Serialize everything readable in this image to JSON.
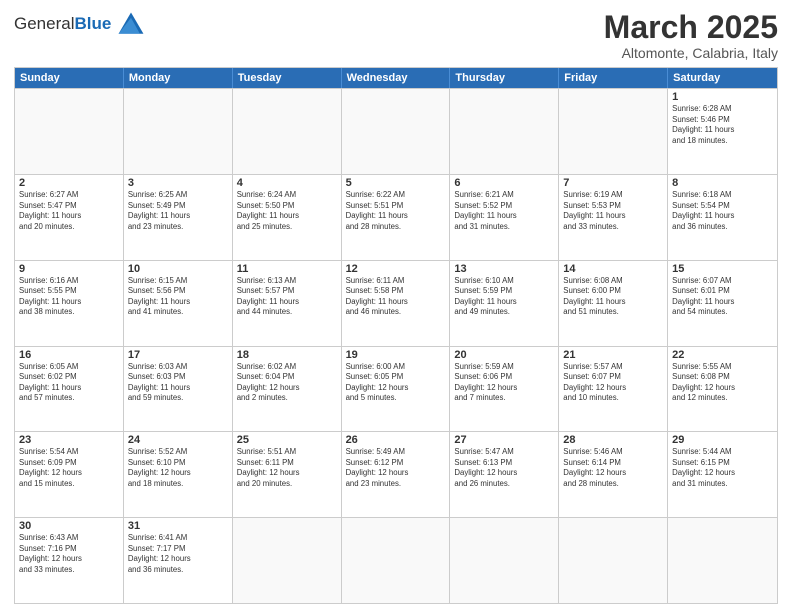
{
  "header": {
    "logo_general": "General",
    "logo_blue": "Blue",
    "month_year": "March 2025",
    "location": "Altomonte, Calabria, Italy"
  },
  "weekdays": [
    "Sunday",
    "Monday",
    "Tuesday",
    "Wednesday",
    "Thursday",
    "Friday",
    "Saturday"
  ],
  "weeks": [
    [
      {
        "day": "",
        "info": ""
      },
      {
        "day": "",
        "info": ""
      },
      {
        "day": "",
        "info": ""
      },
      {
        "day": "",
        "info": ""
      },
      {
        "day": "",
        "info": ""
      },
      {
        "day": "",
        "info": ""
      },
      {
        "day": "1",
        "info": "Sunrise: 6:28 AM\nSunset: 5:46 PM\nDaylight: 11 hours\nand 18 minutes."
      }
    ],
    [
      {
        "day": "2",
        "info": "Sunrise: 6:27 AM\nSunset: 5:47 PM\nDaylight: 11 hours\nand 20 minutes."
      },
      {
        "day": "3",
        "info": "Sunrise: 6:25 AM\nSunset: 5:49 PM\nDaylight: 11 hours\nand 23 minutes."
      },
      {
        "day": "4",
        "info": "Sunrise: 6:24 AM\nSunset: 5:50 PM\nDaylight: 11 hours\nand 25 minutes."
      },
      {
        "day": "5",
        "info": "Sunrise: 6:22 AM\nSunset: 5:51 PM\nDaylight: 11 hours\nand 28 minutes."
      },
      {
        "day": "6",
        "info": "Sunrise: 6:21 AM\nSunset: 5:52 PM\nDaylight: 11 hours\nand 31 minutes."
      },
      {
        "day": "7",
        "info": "Sunrise: 6:19 AM\nSunset: 5:53 PM\nDaylight: 11 hours\nand 33 minutes."
      },
      {
        "day": "8",
        "info": "Sunrise: 6:18 AM\nSunset: 5:54 PM\nDaylight: 11 hours\nand 36 minutes."
      }
    ],
    [
      {
        "day": "9",
        "info": "Sunrise: 6:16 AM\nSunset: 5:55 PM\nDaylight: 11 hours\nand 38 minutes."
      },
      {
        "day": "10",
        "info": "Sunrise: 6:15 AM\nSunset: 5:56 PM\nDaylight: 11 hours\nand 41 minutes."
      },
      {
        "day": "11",
        "info": "Sunrise: 6:13 AM\nSunset: 5:57 PM\nDaylight: 11 hours\nand 44 minutes."
      },
      {
        "day": "12",
        "info": "Sunrise: 6:11 AM\nSunset: 5:58 PM\nDaylight: 11 hours\nand 46 minutes."
      },
      {
        "day": "13",
        "info": "Sunrise: 6:10 AM\nSunset: 5:59 PM\nDaylight: 11 hours\nand 49 minutes."
      },
      {
        "day": "14",
        "info": "Sunrise: 6:08 AM\nSunset: 6:00 PM\nDaylight: 11 hours\nand 51 minutes."
      },
      {
        "day": "15",
        "info": "Sunrise: 6:07 AM\nSunset: 6:01 PM\nDaylight: 11 hours\nand 54 minutes."
      }
    ],
    [
      {
        "day": "16",
        "info": "Sunrise: 6:05 AM\nSunset: 6:02 PM\nDaylight: 11 hours\nand 57 minutes."
      },
      {
        "day": "17",
        "info": "Sunrise: 6:03 AM\nSunset: 6:03 PM\nDaylight: 11 hours\nand 59 minutes."
      },
      {
        "day": "18",
        "info": "Sunrise: 6:02 AM\nSunset: 6:04 PM\nDaylight: 12 hours\nand 2 minutes."
      },
      {
        "day": "19",
        "info": "Sunrise: 6:00 AM\nSunset: 6:05 PM\nDaylight: 12 hours\nand 5 minutes."
      },
      {
        "day": "20",
        "info": "Sunrise: 5:59 AM\nSunset: 6:06 PM\nDaylight: 12 hours\nand 7 minutes."
      },
      {
        "day": "21",
        "info": "Sunrise: 5:57 AM\nSunset: 6:07 PM\nDaylight: 12 hours\nand 10 minutes."
      },
      {
        "day": "22",
        "info": "Sunrise: 5:55 AM\nSunset: 6:08 PM\nDaylight: 12 hours\nand 12 minutes."
      }
    ],
    [
      {
        "day": "23",
        "info": "Sunrise: 5:54 AM\nSunset: 6:09 PM\nDaylight: 12 hours\nand 15 minutes."
      },
      {
        "day": "24",
        "info": "Sunrise: 5:52 AM\nSunset: 6:10 PM\nDaylight: 12 hours\nand 18 minutes."
      },
      {
        "day": "25",
        "info": "Sunrise: 5:51 AM\nSunset: 6:11 PM\nDaylight: 12 hours\nand 20 minutes."
      },
      {
        "day": "26",
        "info": "Sunrise: 5:49 AM\nSunset: 6:12 PM\nDaylight: 12 hours\nand 23 minutes."
      },
      {
        "day": "27",
        "info": "Sunrise: 5:47 AM\nSunset: 6:13 PM\nDaylight: 12 hours\nand 26 minutes."
      },
      {
        "day": "28",
        "info": "Sunrise: 5:46 AM\nSunset: 6:14 PM\nDaylight: 12 hours\nand 28 minutes."
      },
      {
        "day": "29",
        "info": "Sunrise: 5:44 AM\nSunset: 6:15 PM\nDaylight: 12 hours\nand 31 minutes."
      }
    ],
    [
      {
        "day": "30",
        "info": "Sunrise: 6:43 AM\nSunset: 7:16 PM\nDaylight: 12 hours\nand 33 minutes."
      },
      {
        "day": "31",
        "info": "Sunrise: 6:41 AM\nSunset: 7:17 PM\nDaylight: 12 hours\nand 36 minutes."
      },
      {
        "day": "",
        "info": ""
      },
      {
        "day": "",
        "info": ""
      },
      {
        "day": "",
        "info": ""
      },
      {
        "day": "",
        "info": ""
      },
      {
        "day": "",
        "info": ""
      }
    ]
  ]
}
